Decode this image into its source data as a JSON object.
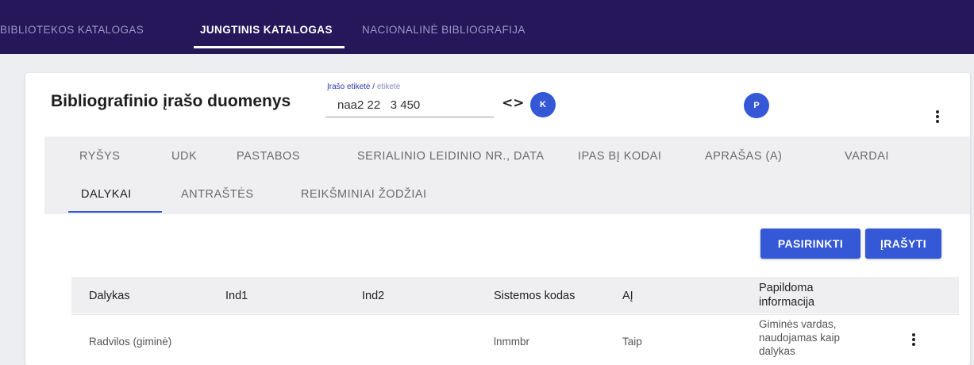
{
  "topnav": {
    "tabs": [
      {
        "label": "BIBLIOTEKOS KATALOGAS"
      },
      {
        "label": "JUNGTINIS KATALOGAS"
      },
      {
        "label": "NACIONALINĖ BIBLIOGRAFIJA"
      }
    ]
  },
  "card": {
    "title": "Bibliografinio įrašo duomenys",
    "label_field": {
      "label_main": "Įrašo etiketė / ",
      "label_sub": "etiketė",
      "value": "naa2 22   3 450"
    },
    "code_glyph": "<>",
    "avatar_k": "K",
    "avatar_p": "P"
  },
  "tabs_row1": [
    "RYŠYS",
    "UDK",
    "PASTABOS",
    "SERIALINIO LEIDINIO NR., DATA",
    "IPAS BĮ KODAI",
    "APRAŠAS (A)",
    "VARDAI"
  ],
  "tabs_row2": [
    "DALYKAI",
    "ANTRAŠTĖS",
    "REIKŠMINIAI ŽODŽIAI"
  ],
  "buttons": {
    "select": "PASIRINKTI",
    "save": "ĮRAŠYTI"
  },
  "table": {
    "headers": {
      "subject": "Dalykas",
      "ind1": "Ind1",
      "ind2": "Ind2",
      "system_code": "Sistemos kodas",
      "aj": "AĮ",
      "extra_line1": "Papildoma",
      "extra_line2": "informacija"
    },
    "rows": [
      {
        "subject": "Radvilos (giminė)",
        "ind1": "",
        "ind2": "",
        "system_code": "lnmmbr",
        "aj": "Taip",
        "extra_line1": "Giminės vardas,",
        "extra_line2": "naudojamas kaip",
        "extra_line3": "dalykas"
      }
    ]
  }
}
